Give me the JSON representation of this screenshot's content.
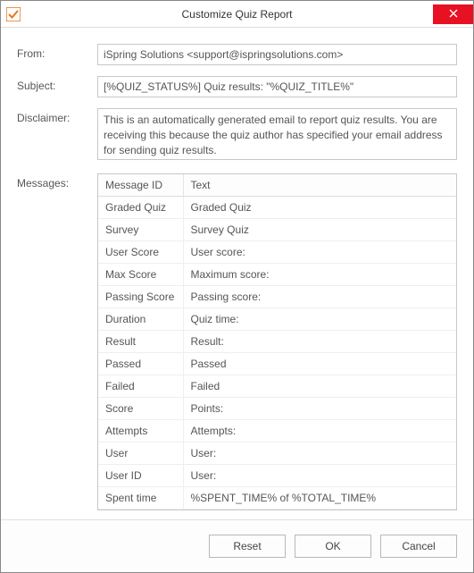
{
  "window": {
    "title": "Customize Quiz Report"
  },
  "labels": {
    "from": "From:",
    "subject": "Subject:",
    "disclaimer": "Disclaimer:",
    "messages": "Messages:"
  },
  "fields": {
    "from": "iSpring Solutions <support@ispringsolutions.com>",
    "subject": "[%QUIZ_STATUS%] Quiz results: \"%QUIZ_TITLE%\"",
    "disclaimer": "This is an automatically generated email to report quiz results. You are receiving this because the quiz author has specified your email address for sending quiz results."
  },
  "table": {
    "headers": {
      "id": "Message ID",
      "text": "Text"
    },
    "rows": [
      {
        "id": "Graded Quiz",
        "text": "Graded Quiz"
      },
      {
        "id": "Survey",
        "text": "Survey Quiz"
      },
      {
        "id": "User Score",
        "text": "User score:"
      },
      {
        "id": "Max Score",
        "text": "Maximum score:"
      },
      {
        "id": "Passing Score",
        "text": "Passing score:"
      },
      {
        "id": "Duration",
        "text": "Quiz time:"
      },
      {
        "id": "Result",
        "text": "Result:"
      },
      {
        "id": "Passed",
        "text": "Passed"
      },
      {
        "id": "Failed",
        "text": "Failed"
      },
      {
        "id": "Score",
        "text": "Points:"
      },
      {
        "id": "Attempts",
        "text": "Attempts:"
      },
      {
        "id": "User",
        "text": "User:"
      },
      {
        "id": "User ID",
        "text": "User:"
      },
      {
        "id": "Spent time",
        "text": "%SPENT_TIME% of %TOTAL_TIME%"
      }
    ]
  },
  "buttons": {
    "reset": "Reset",
    "ok": "OK",
    "cancel": "Cancel"
  }
}
